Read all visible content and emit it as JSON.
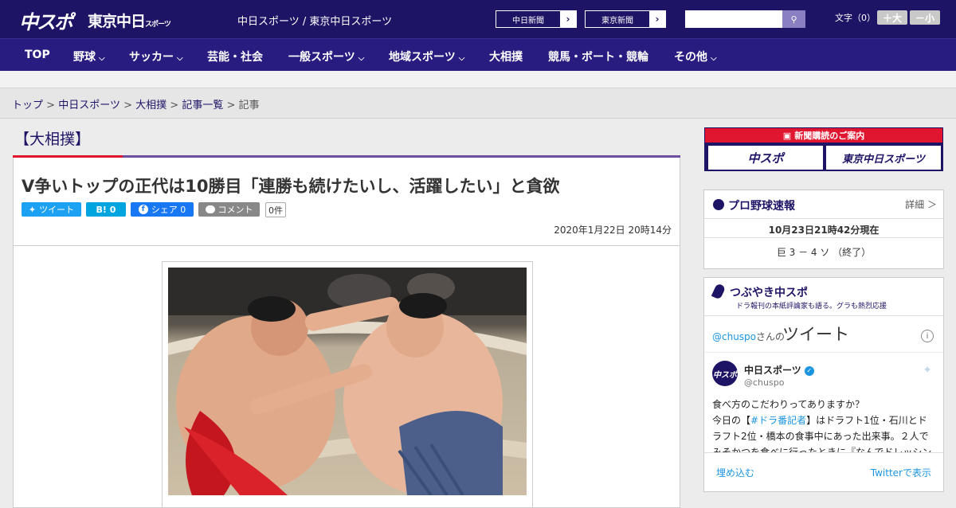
{
  "header": {
    "logo_main": "中スポ",
    "logo_sub": "東京中日",
    "logo_sub_small": "スポーツ",
    "site_title": "中日スポーツ / 東京中日スポーツ",
    "paper_links": [
      "中日新聞",
      "東京新聞"
    ],
    "search": {
      "placeholder": ""
    },
    "fontsize_label": "文字（0）",
    "font_up": "＋大",
    "font_down": "－小"
  },
  "nav": {
    "items": [
      {
        "label": "TOP"
      },
      {
        "label": "野球"
      },
      {
        "label": "サッカー"
      },
      {
        "label": "芸能・社会"
      },
      {
        "label": "一般スポーツ"
      },
      {
        "label": "地域スポーツ"
      },
      {
        "label": "大相撲"
      },
      {
        "label": "競馬・ボート・競輪"
      },
      {
        "label": "その他"
      }
    ]
  },
  "breadcrumb": {
    "items": [
      "トップ",
      "中日スポーツ",
      "大相撲",
      "記事一覧"
    ],
    "current": "記事",
    "separator": ">"
  },
  "section": {
    "title": "【大相撲】"
  },
  "article": {
    "headline": "V争いトップの正代は10勝目「連勝も続けたいし、活躍したい」と貪欲",
    "share": {
      "tweet": "ツイート",
      "hatena": "B! 0",
      "facebook": "シェア 0",
      "comment": "コメント",
      "comment_count": "0件"
    },
    "date": "2020年1月22日 20時14分"
  },
  "sidebar": {
    "banner": {
      "title": "新聞購読のご案内",
      "btn1": "中スポ",
      "btn2": "東京中日スポーツ"
    },
    "baseball": {
      "title": "プロ野球速報",
      "more": "詳細 ＞",
      "timestamp": "10月23日21時42分現在",
      "score": "巨 3 － 4 ソ （終了）"
    },
    "tweets": {
      "title": "つぶやき中スポ",
      "subtitle": "ドラ報刊の本紙評論家も語る。グラも熱烈応援",
      "handle_line": "@chuspo",
      "handle_suffix": "さんの",
      "heading": "ツイート",
      "user_name": "中日スポーツ",
      "user_handle": "@chuspo",
      "text_line1": "食べ方のこだわりってありますか？",
      "text_line2_pre": "今日の【",
      "text_line2_tag": "#ドラ番記者",
      "text_line2_post": "】はドラフト1位・石川とドラフト2位・橋本の食事中にあった出来事。２人でみそかつを食べに行ったときに『なんでドレッシング",
      "embed": "埋め込む",
      "view_on": "Twitterで表示"
    }
  },
  "colors": {
    "brand": "#1e1466",
    "nav": "#281c80",
    "accent_red": "#e0152f",
    "twitter": "#1da1f2",
    "facebook": "#1877f2",
    "hatena": "#00a4de"
  }
}
